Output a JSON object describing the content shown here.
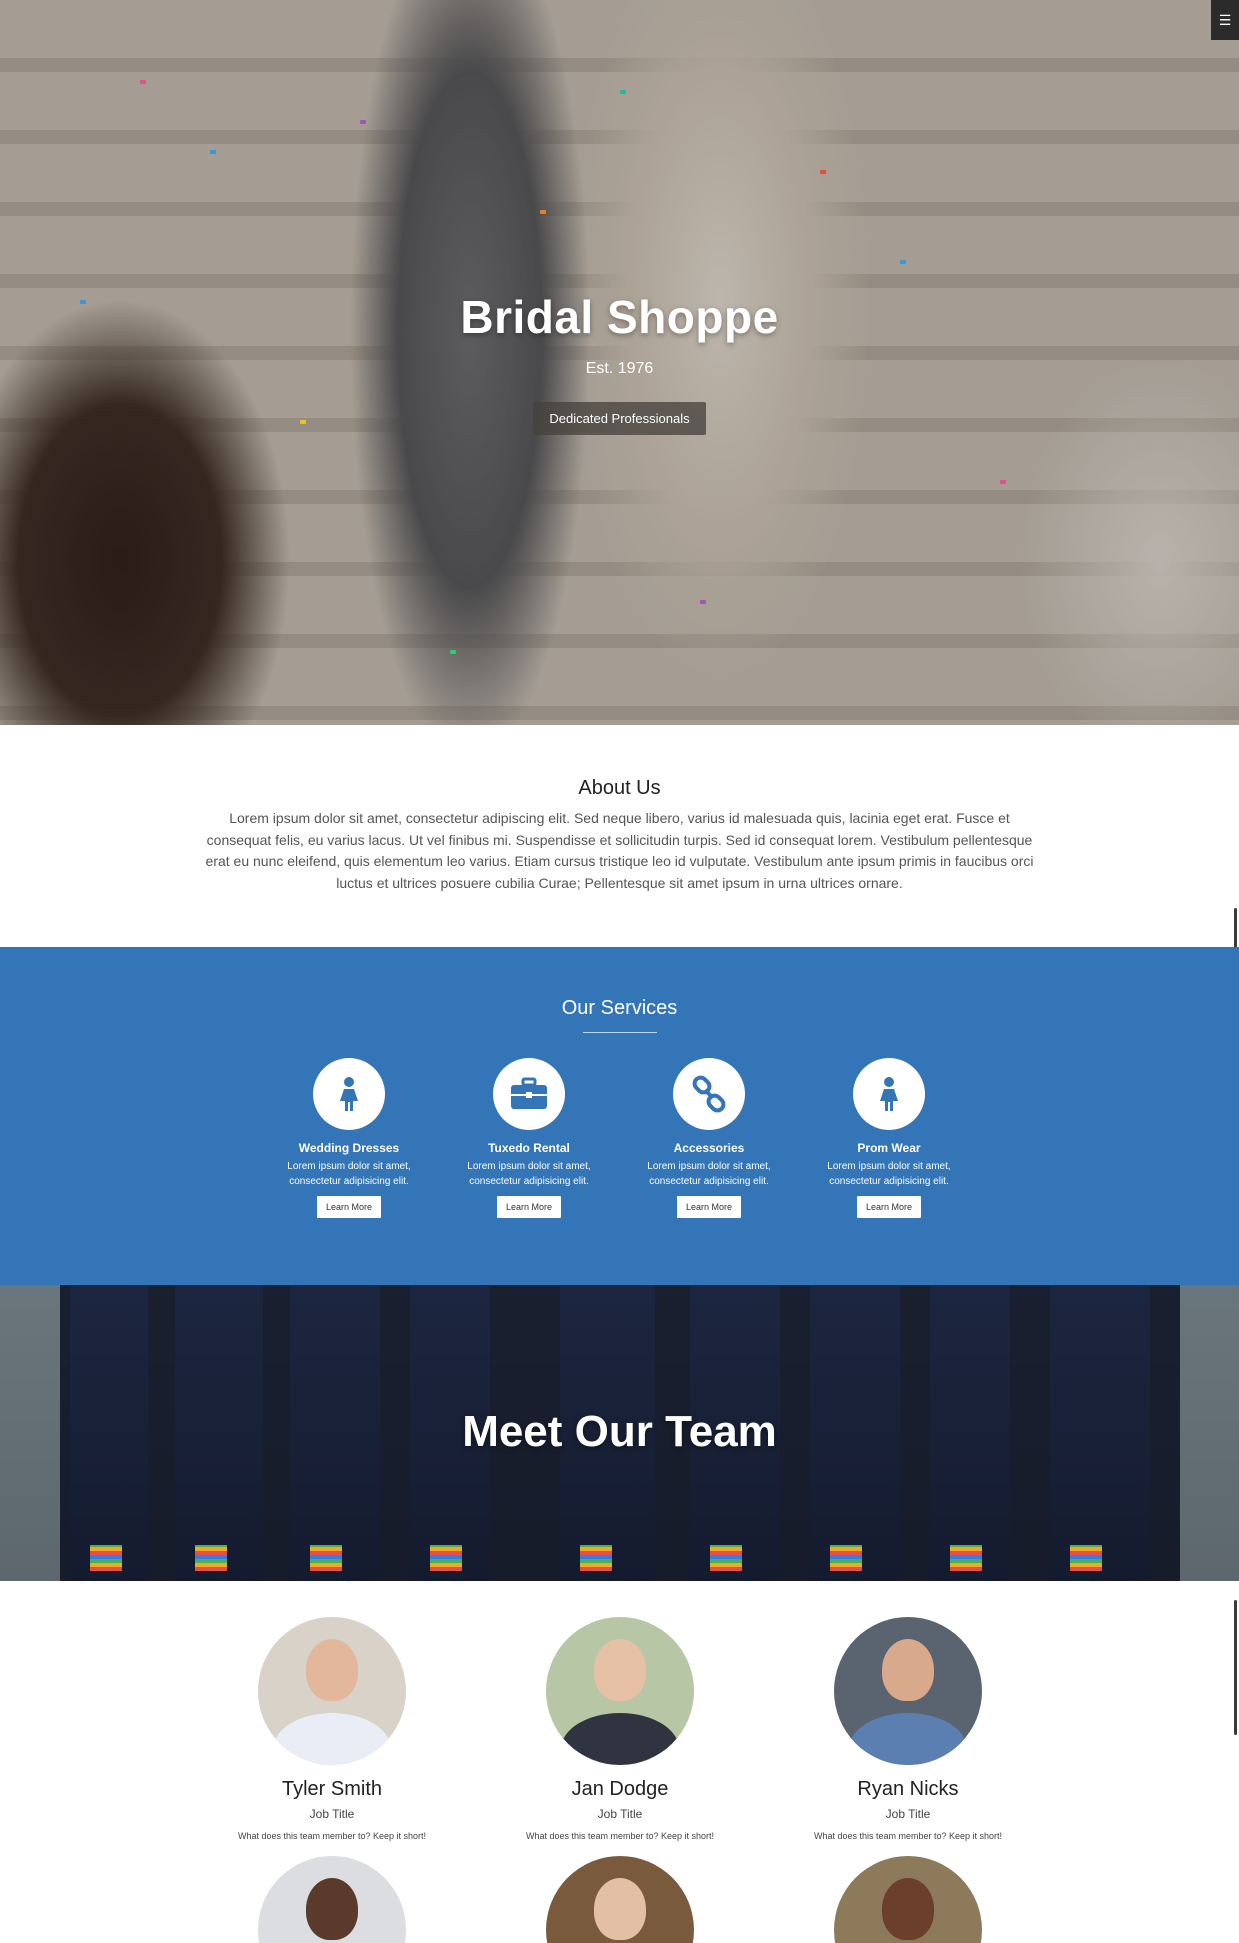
{
  "hero": {
    "title": "Bridal Shoppe",
    "subtitle": "Est. 1976",
    "button": "Dedicated Professionals",
    "menu_icon": "☰"
  },
  "about": {
    "title": "About Us",
    "text": "Lorem ipsum dolor sit amet, consectetur adipiscing elit. Sed neque libero, varius id malesuada quis, lacinia eget erat. Fusce et consequat felis, eu varius lacus. Ut vel finibus mi. Suspendisse et sollicitudin turpis. Sed id consequat lorem. Vestibulum pellentesque erat eu nunc eleifend, quis elementum leo varius. Etiam cursus tristique leo id vulputate. Vestibulum ante ipsum primis in faucibus orci luctus et ultrices posuere cubilia Curae; Pellentesque sit amet ipsum in urna ultrices ornare."
  },
  "services": {
    "title": "Our Services",
    "items": [
      {
        "title": "Wedding Dresses",
        "text": "Lorem ipsum dolor sit amet, consectetur adipisicing elit.",
        "button": "Learn More",
        "icon": "female-icon"
      },
      {
        "title": "Tuxedo Rental",
        "text": "Lorem ipsum dolor sit amet, consectetur adipisicing elit.",
        "button": "Learn More",
        "icon": "briefcase-icon"
      },
      {
        "title": "Accessories",
        "text": "Lorem ipsum dolor sit amet, consectetur adipisicing elit.",
        "button": "Learn More",
        "icon": "link-icon"
      },
      {
        "title": "Prom Wear",
        "text": "Lorem ipsum dolor sit amet, consectetur adipisicing elit.",
        "button": "Learn More",
        "icon": "female-icon"
      }
    ],
    "accent_color": "#3375b6"
  },
  "team": {
    "banner_title": "Meet Our Team",
    "members": [
      {
        "name": "Tyler Smith",
        "title": "Job Title",
        "desc": "What does this team member to? Keep it short!"
      },
      {
        "name": "Jan Dodge",
        "title": "Job Title",
        "desc": "What does this team member to? Keep it short!"
      },
      {
        "name": "Ryan Nicks",
        "title": "Job Title",
        "desc": "What does this team member to? Keep it short!"
      }
    ]
  }
}
